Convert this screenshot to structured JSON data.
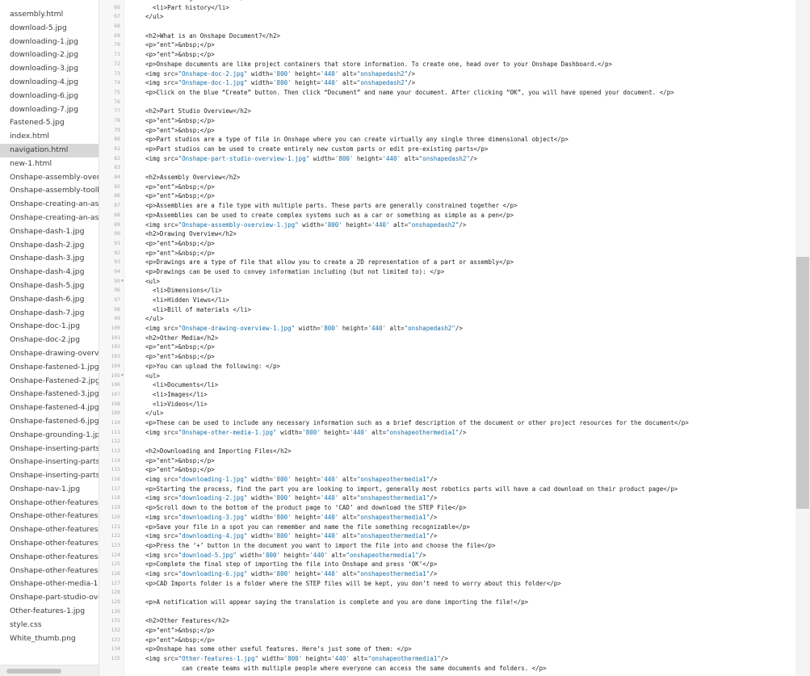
{
  "files": [
    {
      "name": "assembly.html"
    },
    {
      "name": "download-5.jpg"
    },
    {
      "name": "downloading-1.jpg"
    },
    {
      "name": "downloading-2.jpg"
    },
    {
      "name": "downloading-3.jpg"
    },
    {
      "name": "downloading-4.jpg"
    },
    {
      "name": "downloading-6.jpg"
    },
    {
      "name": "downloading-7.jpg"
    },
    {
      "name": "Fastened-5.jpg"
    },
    {
      "name": "index.html"
    },
    {
      "name": "navigation.html",
      "active": true
    },
    {
      "name": "new-1.html"
    },
    {
      "name": "Onshape-assembly-overv"
    },
    {
      "name": "Onshape-assembly-toolba"
    },
    {
      "name": "Onshape-creating-an-asse"
    },
    {
      "name": "Onshape-creating-an-asse"
    },
    {
      "name": "Onshape-dash-1.jpg"
    },
    {
      "name": "Onshape-dash-2.jpg"
    },
    {
      "name": "Onshape-dash-3.jpg"
    },
    {
      "name": "Onshape-dash-4.jpg"
    },
    {
      "name": "Onshape-dash-5.jpg"
    },
    {
      "name": "Onshape-dash-6.jpg"
    },
    {
      "name": "Onshape-dash-7.jpg"
    },
    {
      "name": "Onshape-doc-1.jpg"
    },
    {
      "name": "Onshape-doc-2.jpg"
    },
    {
      "name": "Onshape-drawing-overview"
    },
    {
      "name": "Onshape-fastened-1.jpg"
    },
    {
      "name": "Onshape-Fastened-2.jpg"
    },
    {
      "name": "Onshape-fastened-3.jpg"
    },
    {
      "name": "Onshape-fastened-4.jpg"
    },
    {
      "name": "Onshape-fastened-6.jpg"
    },
    {
      "name": "Onshape-grounding-1.jpg"
    },
    {
      "name": "Onshape-inserting-parts-1."
    },
    {
      "name": "Onshape-inserting-parts-2."
    },
    {
      "name": "Onshape-inserting-parts-3."
    },
    {
      "name": "Onshape-nav-1.jpg"
    },
    {
      "name": "Onshape-other-features-2."
    },
    {
      "name": "Onshape-other-features-3."
    },
    {
      "name": "Onshape-other-features-4."
    },
    {
      "name": "Onshape-other-features-5."
    },
    {
      "name": "Onshape-other-features-6."
    },
    {
      "name": "Onshape-other-features-7."
    },
    {
      "name": "Onshape-other-media-1.jpg"
    },
    {
      "name": "Onshape-part-studio-overv"
    },
    {
      "name": "Other-features-1.jpg"
    },
    {
      "name": "style.css"
    },
    {
      "name": "White_thumb.png"
    }
  ],
  "code_lines": [
    {
      "n": "65",
      "indent": "  ",
      "text": "<li>Sharing information</li>"
    },
    {
      "n": "66",
      "indent": "  ",
      "text": "<li>Part history</li>"
    },
    {
      "n": "67",
      "indent": "",
      "text": "</ul>"
    },
    {
      "n": "68",
      "indent": "",
      "text": ""
    },
    {
      "n": "69",
      "indent": "",
      "text": "<h2>What is an Onshape Document?</h2>"
    },
    {
      "n": "70",
      "indent": "",
      "text": "<p>&nbsp;</p>"
    },
    {
      "n": "71",
      "indent": "",
      "text": "<p>&nbsp;</p>"
    },
    {
      "n": "72",
      "indent": "",
      "text": "<p>Onshape documents are like project containers that store information. To create one, head over to your Onshape Dashboard.</p>"
    },
    {
      "n": "73",
      "indent": "",
      "text": "<img src=\"Onshape-doc-2.jpg\" width='800' height='440' alt=\"onshapedash2\"/>"
    },
    {
      "n": "74",
      "indent": "",
      "text": "<img src=\"Onshape-doc-1.jpg\" width='800' height='440' alt=\"onshapedash2\"/>"
    },
    {
      "n": "75",
      "indent": "",
      "text": "<p>Click on the blue “Create” button. Then click “Document” and name your document. After clicking “OK”, you will have opened your document. </p>"
    },
    {
      "n": "76",
      "indent": "",
      "text": ""
    },
    {
      "n": "77",
      "indent": "",
      "text": "<h2>Part Studio Overview</h2>"
    },
    {
      "n": "78",
      "indent": "",
      "text": "<p>&nbsp;</p>"
    },
    {
      "n": "79",
      "indent": "",
      "text": "<p>&nbsp;</p>"
    },
    {
      "n": "80",
      "indent": "",
      "text": "<p>Part studios are a type of file in Onshape where you can create virtually any single three dimensional object</p>"
    },
    {
      "n": "81",
      "indent": "",
      "text": "<p>Part studios can be used to create entirely new custom parts or edit pre-existing parts</p>"
    },
    {
      "n": "82",
      "indent": "",
      "text": "<img src=\"Onshape-part-studio-overview-1.jpg\" width='800' height='440' alt=\"onshapedash2\"/>"
    },
    {
      "n": "83",
      "indent": "",
      "text": ""
    },
    {
      "n": "84",
      "indent": "",
      "text": "<h2>Assembly Overview</h2>"
    },
    {
      "n": "85",
      "indent": "",
      "text": "<p>&nbsp;</p>"
    },
    {
      "n": "86",
      "indent": "",
      "text": "<p>&nbsp;</p>"
    },
    {
      "n": "87",
      "indent": "",
      "text": "<p>Assemblies are a file type with multiple parts. These parts are generally constrained together </p>"
    },
    {
      "n": "88",
      "indent": "",
      "text": "<p>Assemblies can be used to create complex systems such as a car or something as simple as a pen</p>"
    },
    {
      "n": "89",
      "indent": "",
      "text": "<img src=\"Onshape-assembly-overview-1.jpg\" width='800' height='440' alt=\"onshapedash2\"/>"
    },
    {
      "n": "90",
      "indent": "",
      "text": "<h2>Drawing Overview</h2>"
    },
    {
      "n": "91",
      "indent": "",
      "text": "<p>&nbsp;</p>"
    },
    {
      "n": "92",
      "indent": "",
      "text": "<p>&nbsp;</p>"
    },
    {
      "n": "93",
      "indent": "",
      "text": "<p>Drawings are a type of file that allow you to create a 2D representation of a part or assembly</p>"
    },
    {
      "n": "94",
      "indent": "",
      "text": "<p>Drawings can be used to convey information including (but not limited to): </p>"
    },
    {
      "n": "95",
      "indent": "",
      "text": "<ul>",
      "fold": true
    },
    {
      "n": "96",
      "indent": "  ",
      "text": "<li>Dimensions</li>"
    },
    {
      "n": "97",
      "indent": "  ",
      "text": "<li>Hidden Views</li>"
    },
    {
      "n": "98",
      "indent": "  ",
      "text": "<li>Bill of materials </li>"
    },
    {
      "n": "99",
      "indent": "",
      "text": "</ul>"
    },
    {
      "n": "100",
      "indent": "",
      "text": "<img src=\"Onshape-drawing-overview-1.jpg\" width='800' height='440' alt=\"onshapedash2\"/>"
    },
    {
      "n": "101",
      "indent": "",
      "text": "<h2>Other Media</h2>"
    },
    {
      "n": "102",
      "indent": "",
      "text": "<p>&nbsp;</p>"
    },
    {
      "n": "103",
      "indent": "",
      "text": "<p>&nbsp;</p>"
    },
    {
      "n": "104",
      "indent": "",
      "text": "<p>You can upload the following: </p>"
    },
    {
      "n": "105",
      "indent": "",
      "text": "<ul>",
      "fold": true
    },
    {
      "n": "106",
      "indent": "  ",
      "text": "<li>Documents</li>"
    },
    {
      "n": "107",
      "indent": "  ",
      "text": "<li>Images</li>"
    },
    {
      "n": "108",
      "indent": "  ",
      "text": "<li>Videos</li>"
    },
    {
      "n": "109",
      "indent": "",
      "text": "</ul>"
    },
    {
      "n": "110",
      "indent": "",
      "text": "<p>These can be used to include any necessary information such as a brief description of the document or other project resources for the document</p>"
    },
    {
      "n": "111",
      "indent": "",
      "text": "<img src=\"Onshape-other-media-1.jpg\" width='800' height='440' alt=\"onshapeothermedia1\"/>"
    },
    {
      "n": "112",
      "indent": "",
      "text": ""
    },
    {
      "n": "113",
      "indent": "",
      "text": "<h2>Downloading and Importing Files</h2>"
    },
    {
      "n": "114",
      "indent": "",
      "text": "<p>&nbsp;</p>"
    },
    {
      "n": "115",
      "indent": "",
      "text": "<p>&nbsp;</p>"
    },
    {
      "n": "116",
      "indent": "",
      "text": "<img src=\"downloading-1.jpg\" width='800' height='440' alt=\"onshapeothermedia1\"/>"
    },
    {
      "n": "117",
      "indent": "",
      "text": "<p>Starting the process, find the part you are looking to import, generally most robotics parts will have a cad download on their product page</p>"
    },
    {
      "n": "118",
      "indent": "",
      "text": "<img src=\"downloading-2.jpg\" width='800' height='440' alt=\"onshapeothermedia1\"/>"
    },
    {
      "n": "119",
      "indent": "",
      "text": "<p>Scroll down to the bottom of the product page to ‘CAD’ and download the STEP File</p>"
    },
    {
      "n": "120",
      "indent": "",
      "text": "<img src=\"downloading-3.jpg\" width='800' height='440' alt=\"onshapeothermedia1\"/>"
    },
    {
      "n": "121",
      "indent": "",
      "text": "<p>Save your file in a spot you can remember and name the file something recognizable</p>"
    },
    {
      "n": "122",
      "indent": "",
      "text": "<img src=\"downloading-4.jpg\" width='800' height='440' alt=\"onshapeothermedia1\"/>"
    },
    {
      "n": "123",
      "indent": "",
      "text": "<p>Press the ‘+’ button in the document you want to import the file into and choose the file</p>"
    },
    {
      "n": "124",
      "indent": "",
      "text": "<img src=\"download-5.jpg\" width='800' height='440' alt=\"onshapeothermedia1\"/>"
    },
    {
      "n": "125",
      "indent": "",
      "text": "<p>Complete the final step of importing the file into Onshape and press ‘OK’</p>"
    },
    {
      "n": "126",
      "indent": "",
      "text": "<img src=\"downloading-6.jpg\" width='800' height='440' alt=\"onshapeothermedia1\"/>"
    },
    {
      "n": "127",
      "indent": "",
      "text": "<p>CAD Imports folder is a folder where the STEP files will be kept, you don’t need to worry about this folder</p>"
    },
    {
      "n": "128",
      "indent": "",
      "text": ""
    },
    {
      "n": "129",
      "indent": "",
      "text": "<p>A notification will appear saying the translation is complete and you are done importing the file!</p>"
    },
    {
      "n": "130",
      "indent": "",
      "text": ""
    },
    {
      "n": "131",
      "indent": "",
      "text": "<h2>Other Features</h2>"
    },
    {
      "n": "132",
      "indent": "",
      "text": "<p>&nbsp;</p>"
    },
    {
      "n": "133",
      "indent": "",
      "text": "<p>&nbsp;</p>"
    },
    {
      "n": "134",
      "indent": "",
      "text": "<p>Onshape has some other useful features. Here’s just some of them: </p>"
    },
    {
      "n": "135",
      "indent": "",
      "text": "<img src=\"Other-features-1.jpg\" width='800' height='440' alt=\"onshapeothermedia1\"/>"
    },
    {
      "n": "",
      "indent": "",
      "text": "          can create teams with multiple people where everyone can access the same documents and folders. </p>"
    }
  ],
  "colors": {
    "string": "#1b6fa6",
    "entity": "#b02a2a",
    "text": "#222222"
  }
}
